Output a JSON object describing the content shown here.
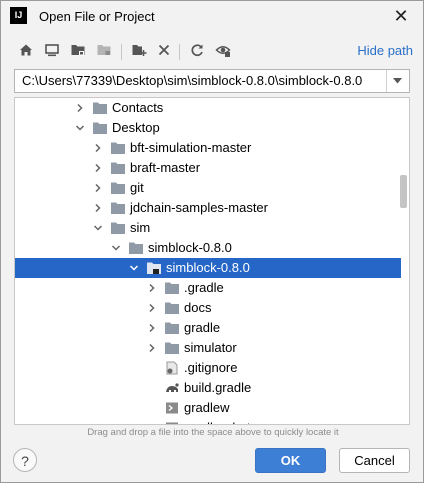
{
  "window": {
    "title": "Open File or Project",
    "app_icon_text": "IJ",
    "close_glyph": "✕"
  },
  "toolbar": {
    "icons": [
      "home-icon",
      "desktop-icon",
      "project-folder-icon",
      "module-folder-icon",
      "new-folder-icon",
      "delete-icon",
      "refresh-icon",
      "show-hidden-icon"
    ],
    "hide_path_label": "Hide path"
  },
  "path": {
    "value": "C:\\Users\\77339\\Desktop\\sim\\simblock-0.8.0\\simblock-0.8.0"
  },
  "tree": {
    "rows": [
      {
        "label": "Contacts",
        "depth": 4,
        "arrow": "collapsed",
        "icon": "folder"
      },
      {
        "label": "Desktop",
        "depth": 4,
        "arrow": "expanded",
        "icon": "folder"
      },
      {
        "label": "bft-simulation-master",
        "depth": 5,
        "arrow": "collapsed",
        "icon": "folder"
      },
      {
        "label": "braft-master",
        "depth": 5,
        "arrow": "collapsed",
        "icon": "folder"
      },
      {
        "label": "git",
        "depth": 5,
        "arrow": "collapsed",
        "icon": "folder"
      },
      {
        "label": "jdchain-samples-master",
        "depth": 5,
        "arrow": "collapsed",
        "icon": "folder"
      },
      {
        "label": "sim",
        "depth": 5,
        "arrow": "expanded",
        "icon": "folder"
      },
      {
        "label": "simblock-0.8.0",
        "depth": 6,
        "arrow": "expanded",
        "icon": "folder"
      },
      {
        "label": "simblock-0.8.0",
        "depth": 7,
        "arrow": "expanded",
        "icon": "project-folder",
        "selected": true
      },
      {
        "label": ".gradle",
        "depth": 8,
        "arrow": "collapsed",
        "icon": "folder"
      },
      {
        "label": "docs",
        "depth": 8,
        "arrow": "collapsed",
        "icon": "folder"
      },
      {
        "label": "gradle",
        "depth": 8,
        "arrow": "collapsed",
        "icon": "folder"
      },
      {
        "label": "simulator",
        "depth": 8,
        "arrow": "collapsed",
        "icon": "folder"
      },
      {
        "label": ".gitignore",
        "depth": 8,
        "arrow": "none",
        "icon": "gitignore-file"
      },
      {
        "label": "build.gradle",
        "depth": 8,
        "arrow": "none",
        "icon": "gradle-file"
      },
      {
        "label": "gradlew",
        "depth": 8,
        "arrow": "none",
        "icon": "script-file"
      },
      {
        "label": "gradlew.bat",
        "depth": 8,
        "arrow": "none",
        "icon": "script-file"
      }
    ]
  },
  "hint": "Drag and drop a file into the space above to quickly locate it",
  "buttons": {
    "help": "?",
    "ok": "OK",
    "cancel": "Cancel"
  },
  "colors": {
    "selection": "#2566c7",
    "link": "#2a6fc9",
    "folder": "#8f9aa6",
    "ok_button": "#3e7fd6"
  }
}
